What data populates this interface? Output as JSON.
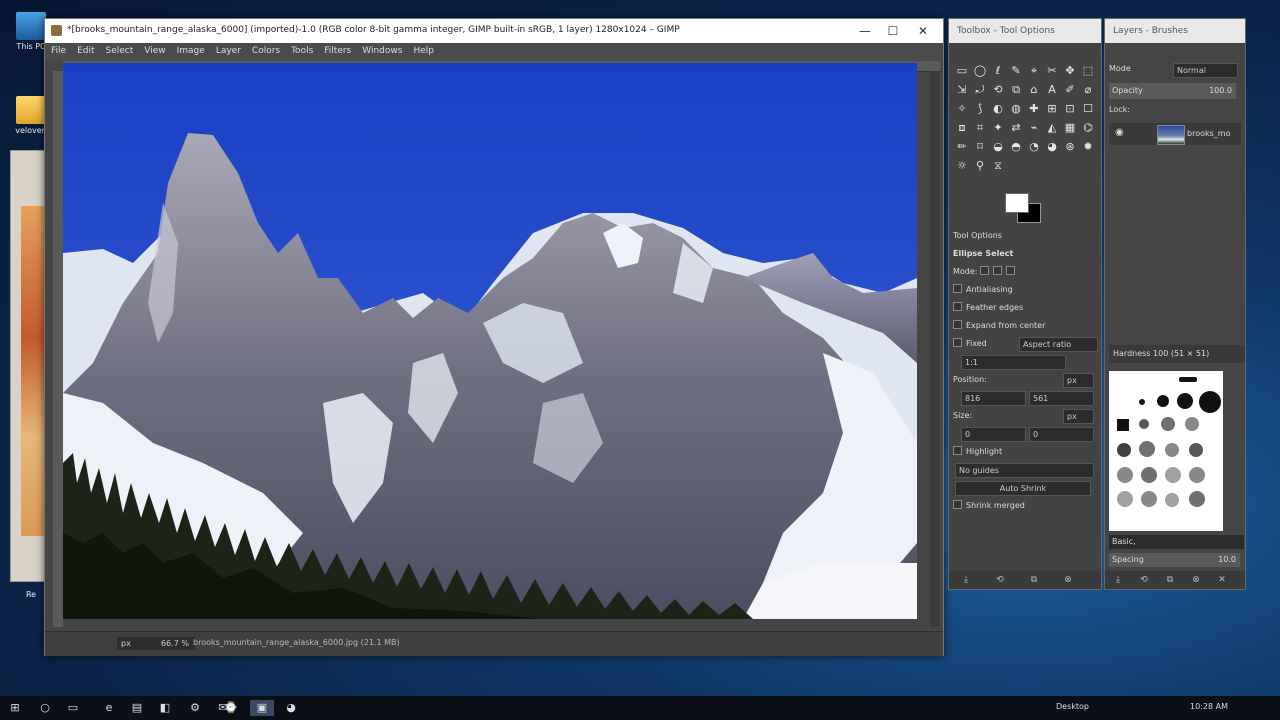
{
  "desktop": {
    "icons": [
      {
        "label": "This PC"
      },
      {
        "label": "veloven"
      },
      {
        "label": "Re"
      }
    ]
  },
  "gimp_window": {
    "title": "*[brooks_mountain_range_alaska_6000] (imported)-1.0 (RGB color 8-bit gamma integer, GIMP built-in sRGB, 1 layer) 1280x1024 – GIMP",
    "controls": {
      "minimize": "—",
      "maximize": "☐",
      "close": "✕"
    },
    "menu": [
      "File",
      "Edit",
      "Select",
      "View",
      "Image",
      "Layer",
      "Colors",
      "Tools",
      "Filters",
      "Windows",
      "Help"
    ],
    "status": {
      "unit": "px",
      "zoom": "66.7 %",
      "file": "brooks_mountain_range_alaska_6000.jpg (21.1 MB)"
    }
  },
  "toolbox_dock": {
    "title": "Toolbox - Tool Options",
    "tools": [
      "▭",
      "◯",
      "ℓ",
      "✎",
      "⌖",
      "✂",
      "✥",
      "⬚",
      "⇲",
      "⤾",
      "⟲",
      "⧉",
      "⌂",
      "A",
      "✐",
      "⌀",
      "✧",
      "⟆",
      "◐",
      "◍",
      "✚",
      "⊞",
      "⊡",
      "☐",
      "⧈",
      "⌗",
      "✦",
      "⇄",
      "⌁",
      "◭",
      "▦",
      "⌬",
      "✏",
      "⌑",
      "◒",
      "◓",
      "◔",
      "◕",
      "⊛",
      "✹",
      "☼",
      "⚲",
      "⧖"
    ],
    "tool_options_header": "Tool Options",
    "tool_name": "Ellipse Select",
    "mode_label": "Mode:",
    "antialiasing": "Antialiasing",
    "feather_edges": "Feather edges",
    "expand_from_center": "Expand from center",
    "fixed_label": "Fixed",
    "fixed_value": "Aspect ratio",
    "ratio_value": "1:1",
    "position_label": "Position:",
    "position_unit": "px",
    "position_x": "816",
    "position_y": "561",
    "size_label": "Size:",
    "size_unit": "px",
    "size_w": "0",
    "size_h": "0",
    "highlight": "Highlight",
    "guides_value": "No guides",
    "auto_shrink": "Auto Shrink",
    "shrink_merged": "Shrink merged",
    "bottom_buttons": [
      "⤓",
      "⟲",
      "⧉",
      "⊗"
    ]
  },
  "layers_dock": {
    "title": "Layers - Brushes",
    "mode_label": "Mode",
    "mode_value": "Normal",
    "opacity_label": "Opacity",
    "opacity_value": "100.0",
    "lock_label": "Lock:",
    "layer_name": "brooks_mo",
    "brushes_header": "Hardness 100 (51 × 51)",
    "brush_tag": "Basic,",
    "spacing_label": "Spacing",
    "spacing_value": "10.0",
    "bottom_buttons": [
      "⤓",
      "⟲",
      "⧉",
      "⊗",
      "✕"
    ]
  },
  "taskbar": {
    "start": "⊞",
    "search": "○",
    "taskview": "▭",
    "apps": [
      "e",
      "▤",
      "◧",
      "⚙",
      "✉",
      "⌚",
      "▣",
      "◕"
    ],
    "desktop_label": "Desktop",
    "clock": "10:28 AM"
  }
}
